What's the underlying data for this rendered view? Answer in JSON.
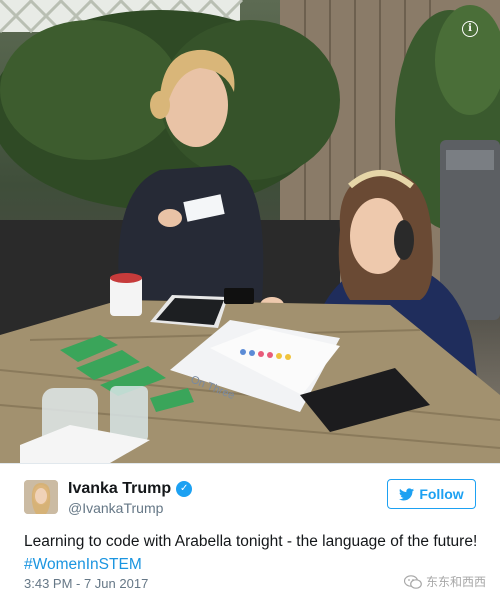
{
  "photo": {
    "notebook_text": "On Three"
  },
  "tweet": {
    "display_name": "Ivanka Trump",
    "handle": "@IvankaTrump",
    "follow_label": "Follow",
    "text_before": "Learning to code with Arabella tonight - the language of the future! ",
    "hashtag": "#WomenInSTEM",
    "timestamp": "3:43 PM - 7 Jun 2017"
  },
  "watermark": {
    "text": "东东和西西"
  },
  "icons": {
    "info": "info-icon",
    "verified": "verified-badge-icon",
    "bird": "twitter-bird-icon",
    "wechat": "wechat-icon"
  },
  "colors": {
    "accent": "#1da1f2",
    "hashtag": "#1b95e0",
    "secondary_text": "#657786"
  }
}
